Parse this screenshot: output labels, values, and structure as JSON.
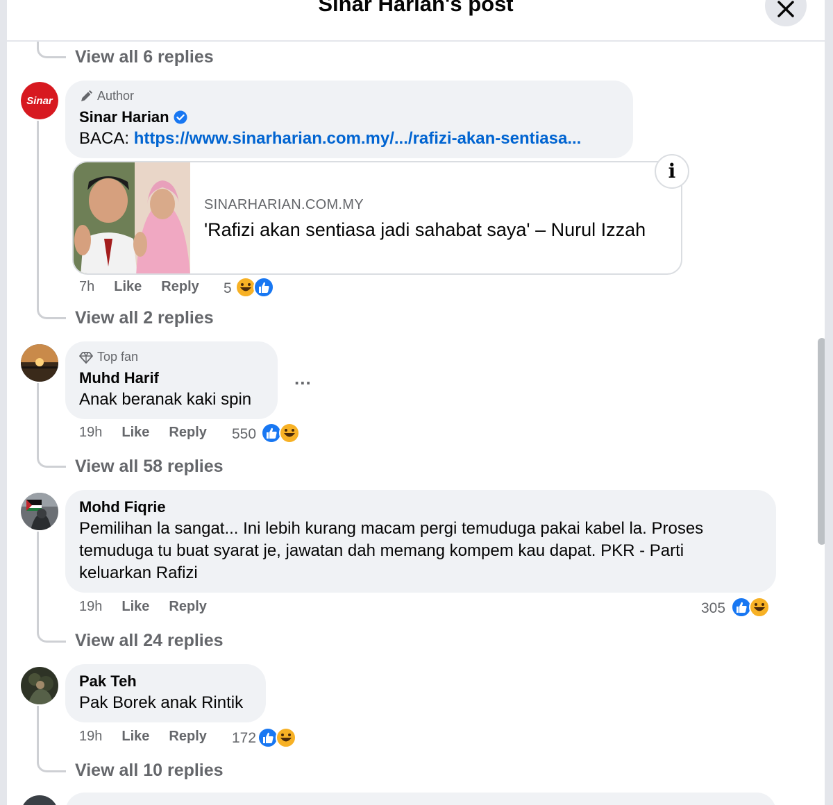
{
  "header": {
    "title": "Sinar Harian's post"
  },
  "thread_top": {
    "view_replies": "View all 6 replies"
  },
  "comments": [
    {
      "badge": "Author",
      "author": "Sinar Harian",
      "verified": true,
      "avatar_text": "Sinar",
      "text_prefix": "BACA: ",
      "link": "https://www.sinarharian.com.my/.../rafizi-akan-sentiasa...",
      "link_card": {
        "domain": "SINARHARIAN.COM.MY",
        "title": "'Rafizi akan sentiasa jadi sahabat saya' – Nurul Izzah",
        "info": "i"
      },
      "time": "7h",
      "like": "Like",
      "reply": "Reply",
      "reaction_count": "5",
      "reactions": [
        "haha",
        "like"
      ],
      "view_replies": "View all 2 replies"
    },
    {
      "badge": "Top fan",
      "author": "Muhd Harif",
      "text": "Anak beranak kaki spin",
      "more": "...",
      "time": "19h",
      "like": "Like",
      "reply": "Reply",
      "reaction_count": "550",
      "reactions": [
        "like",
        "haha"
      ],
      "view_replies": "View all 58 replies"
    },
    {
      "author": "Mohd Fiqrie",
      "text": "Pemilihan la sangat... Ini lebih kurang macam pergi temuduga pakai kabel la. Proses temuduga tu buat syarat je, jawatan dah memang kompem kau dapat. PKR - Parti keluarkan Rafizi",
      "time": "19h",
      "like": "Like",
      "reply": "Reply",
      "reaction_count": "305",
      "reactions": [
        "like",
        "haha"
      ],
      "view_replies": "View all 24 replies"
    },
    {
      "author": "Pak Teh",
      "text": "Pak Borek anak Rintik",
      "time": "19h",
      "like": "Like",
      "reply": "Reply",
      "reaction_count": "172",
      "reactions": [
        "like",
        "haha"
      ],
      "view_replies": "View all 10 replies"
    }
  ],
  "colors": {
    "link": "#0064d1",
    "like": "#1877f2",
    "haha": "#f7b125",
    "bubble": "#f0f2f5",
    "muted": "#65676b",
    "sinar_red": "#d71920"
  },
  "icons": [
    "close-icon",
    "pencil-icon",
    "verified-icon",
    "diamond-icon",
    "info-icon",
    "like-icon",
    "haha-icon",
    "more-icon"
  ]
}
